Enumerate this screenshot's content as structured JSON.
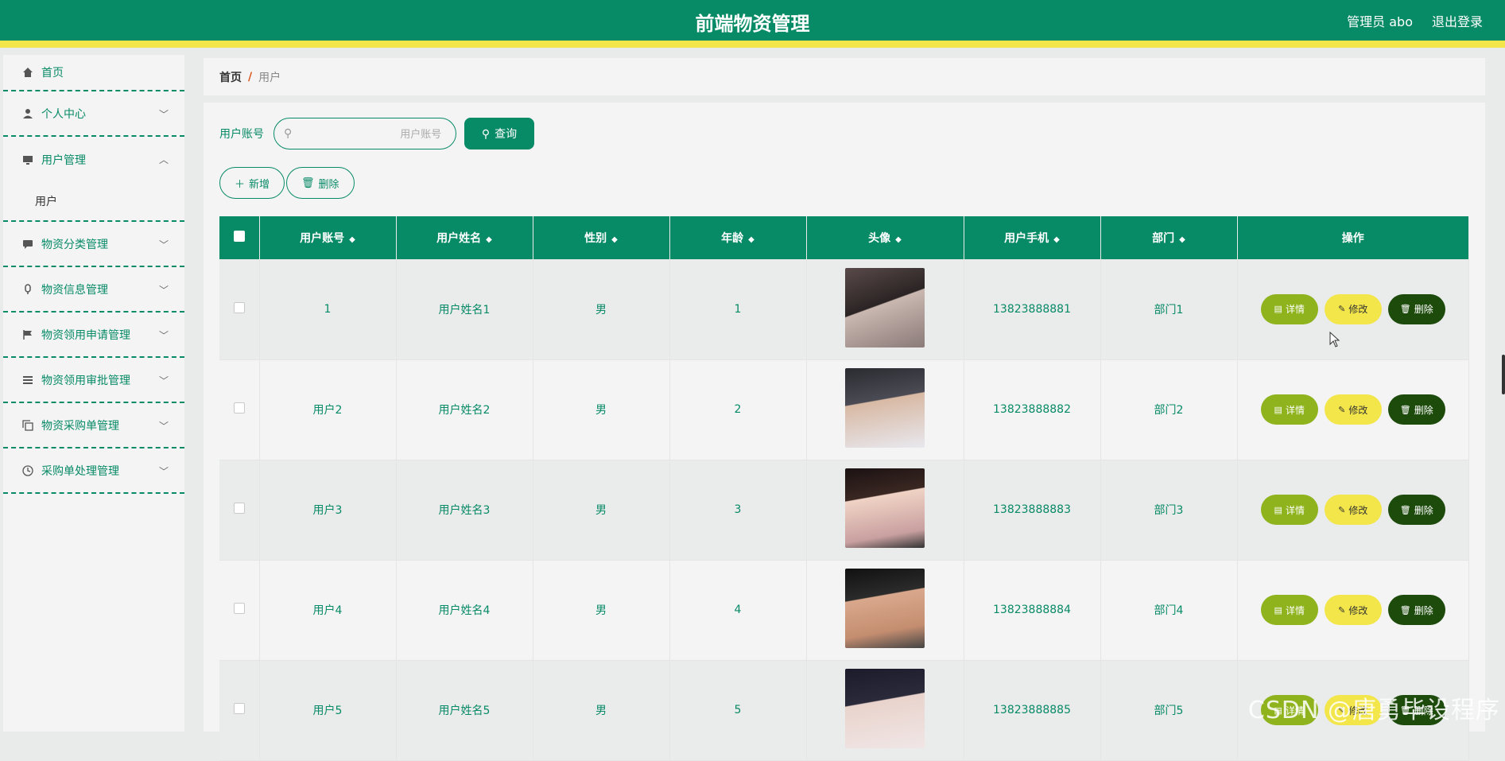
{
  "header": {
    "title": "前端物资管理",
    "user": "管理员 abo",
    "logout": "退出登录",
    "bg_color": "#078a66",
    "accent_color": "#f3e64a"
  },
  "sidebar": {
    "items": [
      {
        "label": "首页",
        "icon": "home-icon"
      },
      {
        "label": "个人中心",
        "icon": "user-icon"
      },
      {
        "label": "用户管理",
        "icon": "monitor-icon",
        "sub": [
          "用户"
        ]
      },
      {
        "label": "物资分类管理",
        "icon": "chat-icon"
      },
      {
        "label": "物资信息管理",
        "icon": "microphone-icon"
      },
      {
        "label": "物资领用申请管理",
        "icon": "flag-icon"
      },
      {
        "label": "物资领用审批管理",
        "icon": "list-icon"
      },
      {
        "label": "物资采购单管理",
        "icon": "copy-icon"
      },
      {
        "label": "采购单处理管理",
        "icon": "clock-icon"
      }
    ]
  },
  "breadcrumb": {
    "home": "首页",
    "sep": "/",
    "current": "用户"
  },
  "search": {
    "label": "用户账号",
    "placeholder": "用户账号",
    "button": "查询"
  },
  "actions": {
    "add": "新增",
    "delete": "删除"
  },
  "table": {
    "headers": [
      "用户账号",
      "用户姓名",
      "性别",
      "年龄",
      "头像",
      "用户手机",
      "部门",
      "操作"
    ],
    "rows": [
      {
        "account": "1",
        "name": "用户姓名1",
        "gender": "男",
        "age": "1",
        "phone": "13823888881",
        "dept": "部门1"
      },
      {
        "account": "用户2",
        "name": "用户姓名2",
        "gender": "男",
        "age": "2",
        "phone": "13823888882",
        "dept": "部门2"
      },
      {
        "account": "用户3",
        "name": "用户姓名3",
        "gender": "男",
        "age": "3",
        "phone": "13823888883",
        "dept": "部门3"
      },
      {
        "account": "用户4",
        "name": "用户姓名4",
        "gender": "男",
        "age": "4",
        "phone": "13823888884",
        "dept": "部门4"
      },
      {
        "account": "用户5",
        "name": "用户姓名5",
        "gender": "男",
        "age": "5",
        "phone": "13823888885",
        "dept": "部门5"
      }
    ],
    "row_buttons": {
      "detail": "详情",
      "edit": "修改",
      "delete": "删除"
    }
  },
  "watermark": "CSDN @唐勇毕设程序"
}
